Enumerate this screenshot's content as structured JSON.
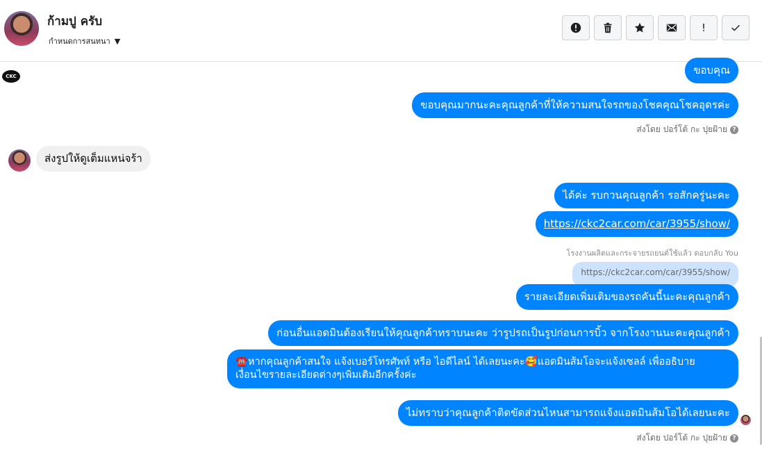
{
  "header": {
    "contact_name": "ก้ามปู ครับ",
    "subtitle": "กำหนดการสนทนา",
    "actions": [
      {
        "icon": "alert-circle-icon",
        "name": "report-button"
      },
      {
        "icon": "trash-icon",
        "name": "delete-button"
      },
      {
        "icon": "star-icon",
        "name": "star-button"
      },
      {
        "icon": "mail-icon",
        "name": "mark-unread-button"
      },
      {
        "icon": "exclamation-icon",
        "name": "priority-button",
        "label": "!"
      },
      {
        "icon": "check-icon",
        "name": "done-button"
      }
    ]
  },
  "messages": {
    "m1": "ขอบคุณ",
    "m2": "ขอบคุณมากนะคะคุณลูกค้าที่ให้ความสนใจรถของโชคคุณโชคอุดรค่ะ",
    "sent_by_1": "ส่งโดย ปอร์โต้ กะ ปุยฝ้าย",
    "in1": "ส่งรูปให้ดูเต็มแหน่จร้า",
    "m3": "ได้ค่ะ รบกวนคุณลูกค้า รอสักครู่นะคะ",
    "m4": "https://ckc2car.com/car/3955/show/",
    "reply_label": "โรงงานผลิตและกระจายรถยนต์ใช้แล้ว ตอบกลับ You",
    "reply_quote": "https://ckc2car.com/car/3955/show/",
    "m5": "รายละเอียดเพิ่มเติมของรถคันนี้นะคะคุณลูกค้า",
    "m6": "ก่อนอื่นแอดมินต้องเรียนให้คุณลูกค้าทราบนะคะ ว่ารูปรถเป็นรูปก่อนการบิ้ว จากโรงงานนะคะคุณลูกค้า",
    "m7_line1": "☎️หากคุณลูกค้าสนใจ แจ้งเบอร์โทรศัพท์ หรือ ไอดีไลน์  ได้เลยนะคะ🥰แอดมินส้มโอจะแจ้งเซลล์   เพื่ออธิบาย",
    "m7_line2": "เงื่อนไขรายละเอียดต่างๆเพิ่มเติมอีกครั้งค่ะ",
    "m8": "ไม่ทราบว่าคุณลูกค้าติดขัดส่วนไหนสามารถแจ้งแอดมินส้มโอได้เลยนะคะ",
    "sent_by_2": "ส่งโดย ปอร์โต้ กะ ปุยฝ้าย",
    "help_glyph": "?"
  },
  "colors": {
    "outgoing": "#0084ff",
    "incoming": "#f1f0f0",
    "reply_quote": "#cde3fb"
  }
}
